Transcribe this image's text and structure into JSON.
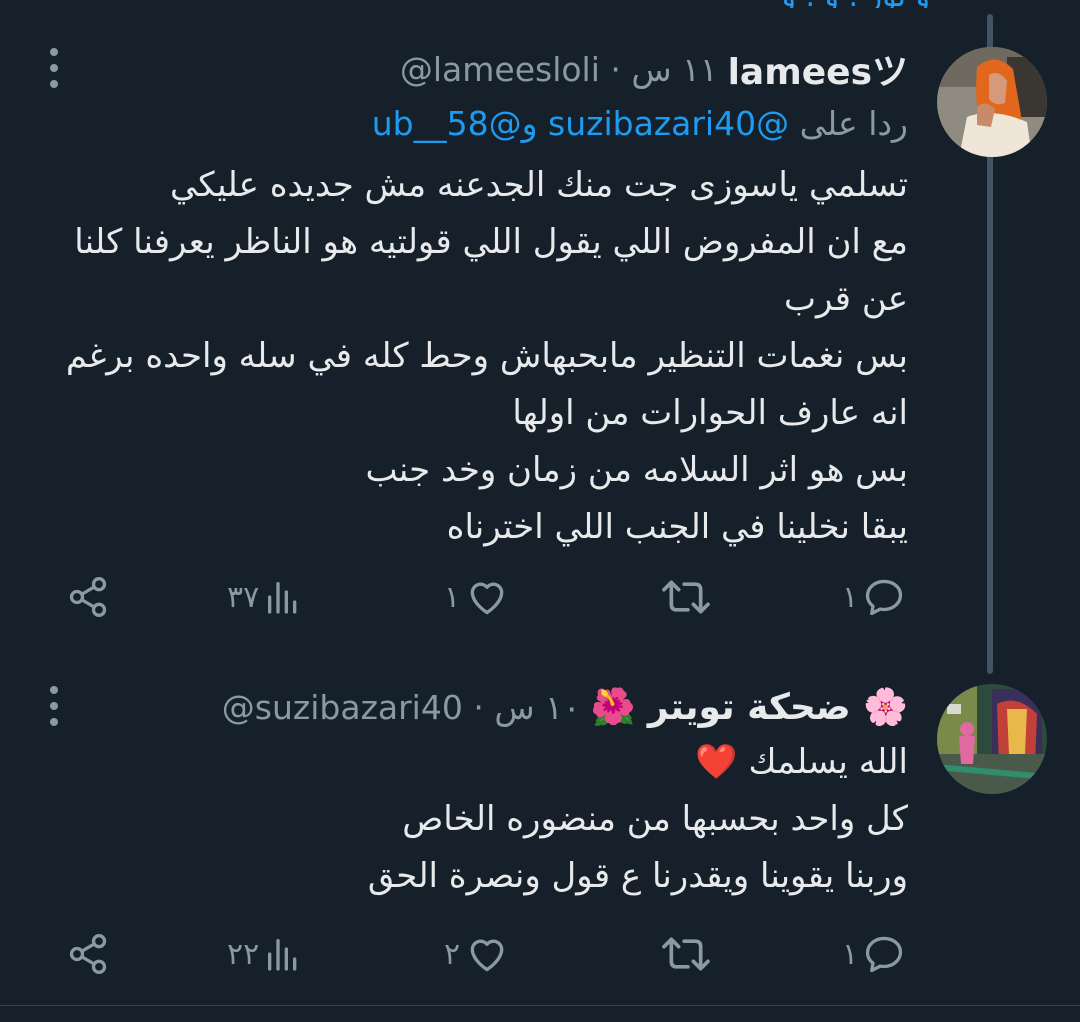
{
  "colors": {
    "background": "#15202b",
    "text": "#e7e9ea",
    "secondary": "#8b98a5",
    "link": "#1d9bf0",
    "thread_line": "#425364"
  },
  "top_remnant": "و نوز . و . و",
  "tweets": [
    {
      "display_name": "lameesツ",
      "handle_time": "@lameesloli · ١١ س",
      "reply_prefix": "ردا على",
      "reply_mentions": "@suzibazari40 و@ub__58",
      "text": "تسلمي ياسوزى جت منك الجدعنه مش جديده عليكي\nمع ان المفروض اللي يقول اللي قولتيه هو الناظر يعرفنا كلنا عن قرب\nبس نغمات التنظير مابحبهاش وحط كله في سله واحده برغم انه عارف الحوارات من اولها\nبس هو اثر السلامه من زمان وخد جنب\nيبقا نخلينا في الجنب اللي اخترناه",
      "replies": "١",
      "retweets": "",
      "likes": "١",
      "views": "٣٧",
      "avatar_icon": "avatar-woman-orange-hijab"
    },
    {
      "display_name": "🌸 ضحكة تويتر 🌺",
      "handle_time": "@suzibazari40 · ١٠ س",
      "text": "الله يسلمك ❤️\nكل واحد بحسبها من منضوره الخاص\nوربنا يقوينا ويقدرنا ع قول ونصرة الحق",
      "replies": "١",
      "retweets": "",
      "likes": "٢",
      "views": "٢٢",
      "avatar_icon": "avatar-colorful-street"
    }
  ]
}
